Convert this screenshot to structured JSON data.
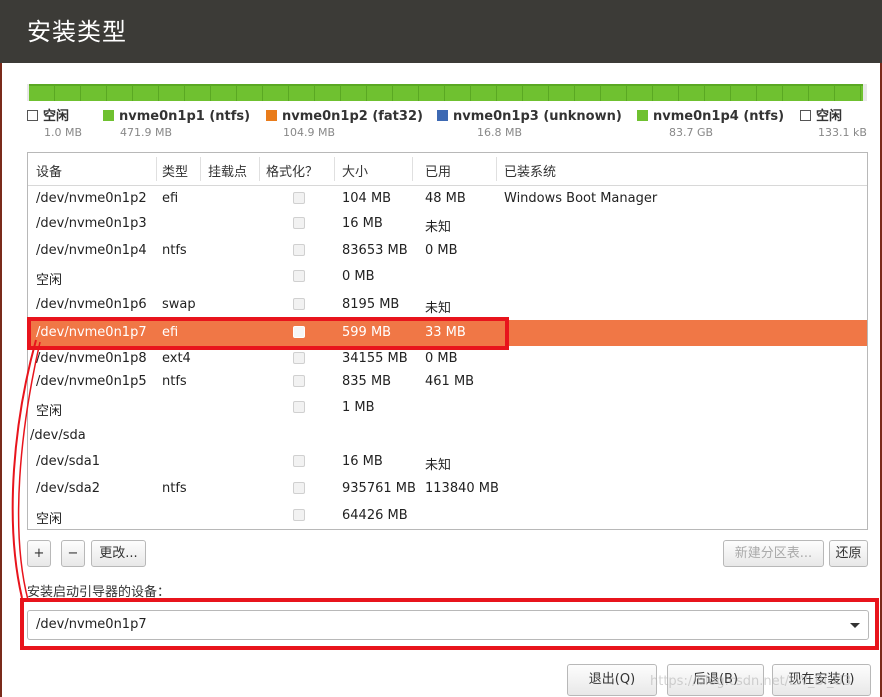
{
  "window": {
    "title": "安装类型"
  },
  "legend": [
    {
      "color": "#ffffff",
      "name": "空闲",
      "size": "1.0 MB"
    },
    {
      "color": "#6fc130",
      "name": "nvme0n1p1 (ntfs)",
      "size": "471.9 MB"
    },
    {
      "color": "#e97c1b",
      "name": "nvme0n1p2 (fat32)",
      "size": "104.9 MB"
    },
    {
      "color": "#3d69b3",
      "name": "nvme0n1p3 (unknown)",
      "size": "16.8 MB"
    },
    {
      "color": "#6fc130",
      "name": "nvme0n1p4 (ntfs)",
      "size": "83.7 GB"
    },
    {
      "color": "#ffffff",
      "name": "空闲",
      "size": "133.1 kB"
    }
  ],
  "table": {
    "headers": [
      "设备",
      "类型",
      "挂载点",
      "格式化？",
      "大小",
      "已用",
      "已装系统"
    ],
    "rows": [
      {
        "device": "/dev/nvme0n1p2",
        "type": "efi",
        "mount": "",
        "format": true,
        "size": "104 MB",
        "used": "48 MB",
        "system": "Windows Boot Manager"
      },
      {
        "device": "/dev/nvme0n1p3",
        "type": "",
        "mount": "",
        "format": true,
        "size": "16 MB",
        "used": "未知",
        "system": ""
      },
      {
        "device": "/dev/nvme0n1p4",
        "type": "ntfs",
        "mount": "",
        "format": true,
        "size": "83653 MB",
        "used": "0 MB",
        "system": ""
      },
      {
        "device": "空闲",
        "type": "",
        "mount": "",
        "format": true,
        "size": "0 MB",
        "used": "",
        "system": ""
      },
      {
        "device": "/dev/nvme0n1p6",
        "type": "swap",
        "mount": "",
        "format": true,
        "size": "8195 MB",
        "used": "未知",
        "system": ""
      },
      {
        "device": "/dev/nvme0n1p7",
        "type": "efi",
        "mount": "",
        "format": true,
        "size": "599 MB",
        "used": "33 MB",
        "system": "",
        "selected": true
      },
      {
        "device": "/dev/nvme0n1p8",
        "type": "ext4",
        "mount": "",
        "format": true,
        "size": "34155 MB",
        "used": "0 MB",
        "system": ""
      },
      {
        "device": "/dev/nvme0n1p5",
        "type": "ntfs",
        "mount": "",
        "format": true,
        "size": "835 MB",
        "used": "461 MB",
        "system": ""
      },
      {
        "device": "空闲",
        "type": "",
        "mount": "",
        "format": true,
        "size": "1 MB",
        "used": "",
        "system": ""
      },
      {
        "device": "/dev/sda",
        "type": "",
        "mount": "",
        "format": false,
        "size": "",
        "used": "",
        "system": "",
        "disk": true
      },
      {
        "device": "/dev/sda1",
        "type": "",
        "mount": "",
        "format": true,
        "size": "16 MB",
        "used": "未知",
        "system": ""
      },
      {
        "device": "/dev/sda2",
        "type": "ntfs",
        "mount": "",
        "format": true,
        "size": "935761 MB",
        "used": "113840 MB",
        "system": ""
      },
      {
        "device": "空闲",
        "type": "",
        "mount": "",
        "format": true,
        "size": "64426 MB",
        "used": "",
        "system": ""
      }
    ]
  },
  "toolbar": {
    "add_label": "+",
    "remove_label": "−",
    "change_label": "更改...",
    "new_table_label": "新建分区表...",
    "revert_label": "还原"
  },
  "bootloader": {
    "label": "安装启动引导器的设备：",
    "value": "/dev/nvme0n1p7"
  },
  "footer": {
    "quit_label": "退出(Q)",
    "back_label": "后退(B)",
    "install_label": "现在安装(I)"
  },
  "watermark": "https://blog.csdn.net/LW_Bl_U3"
}
